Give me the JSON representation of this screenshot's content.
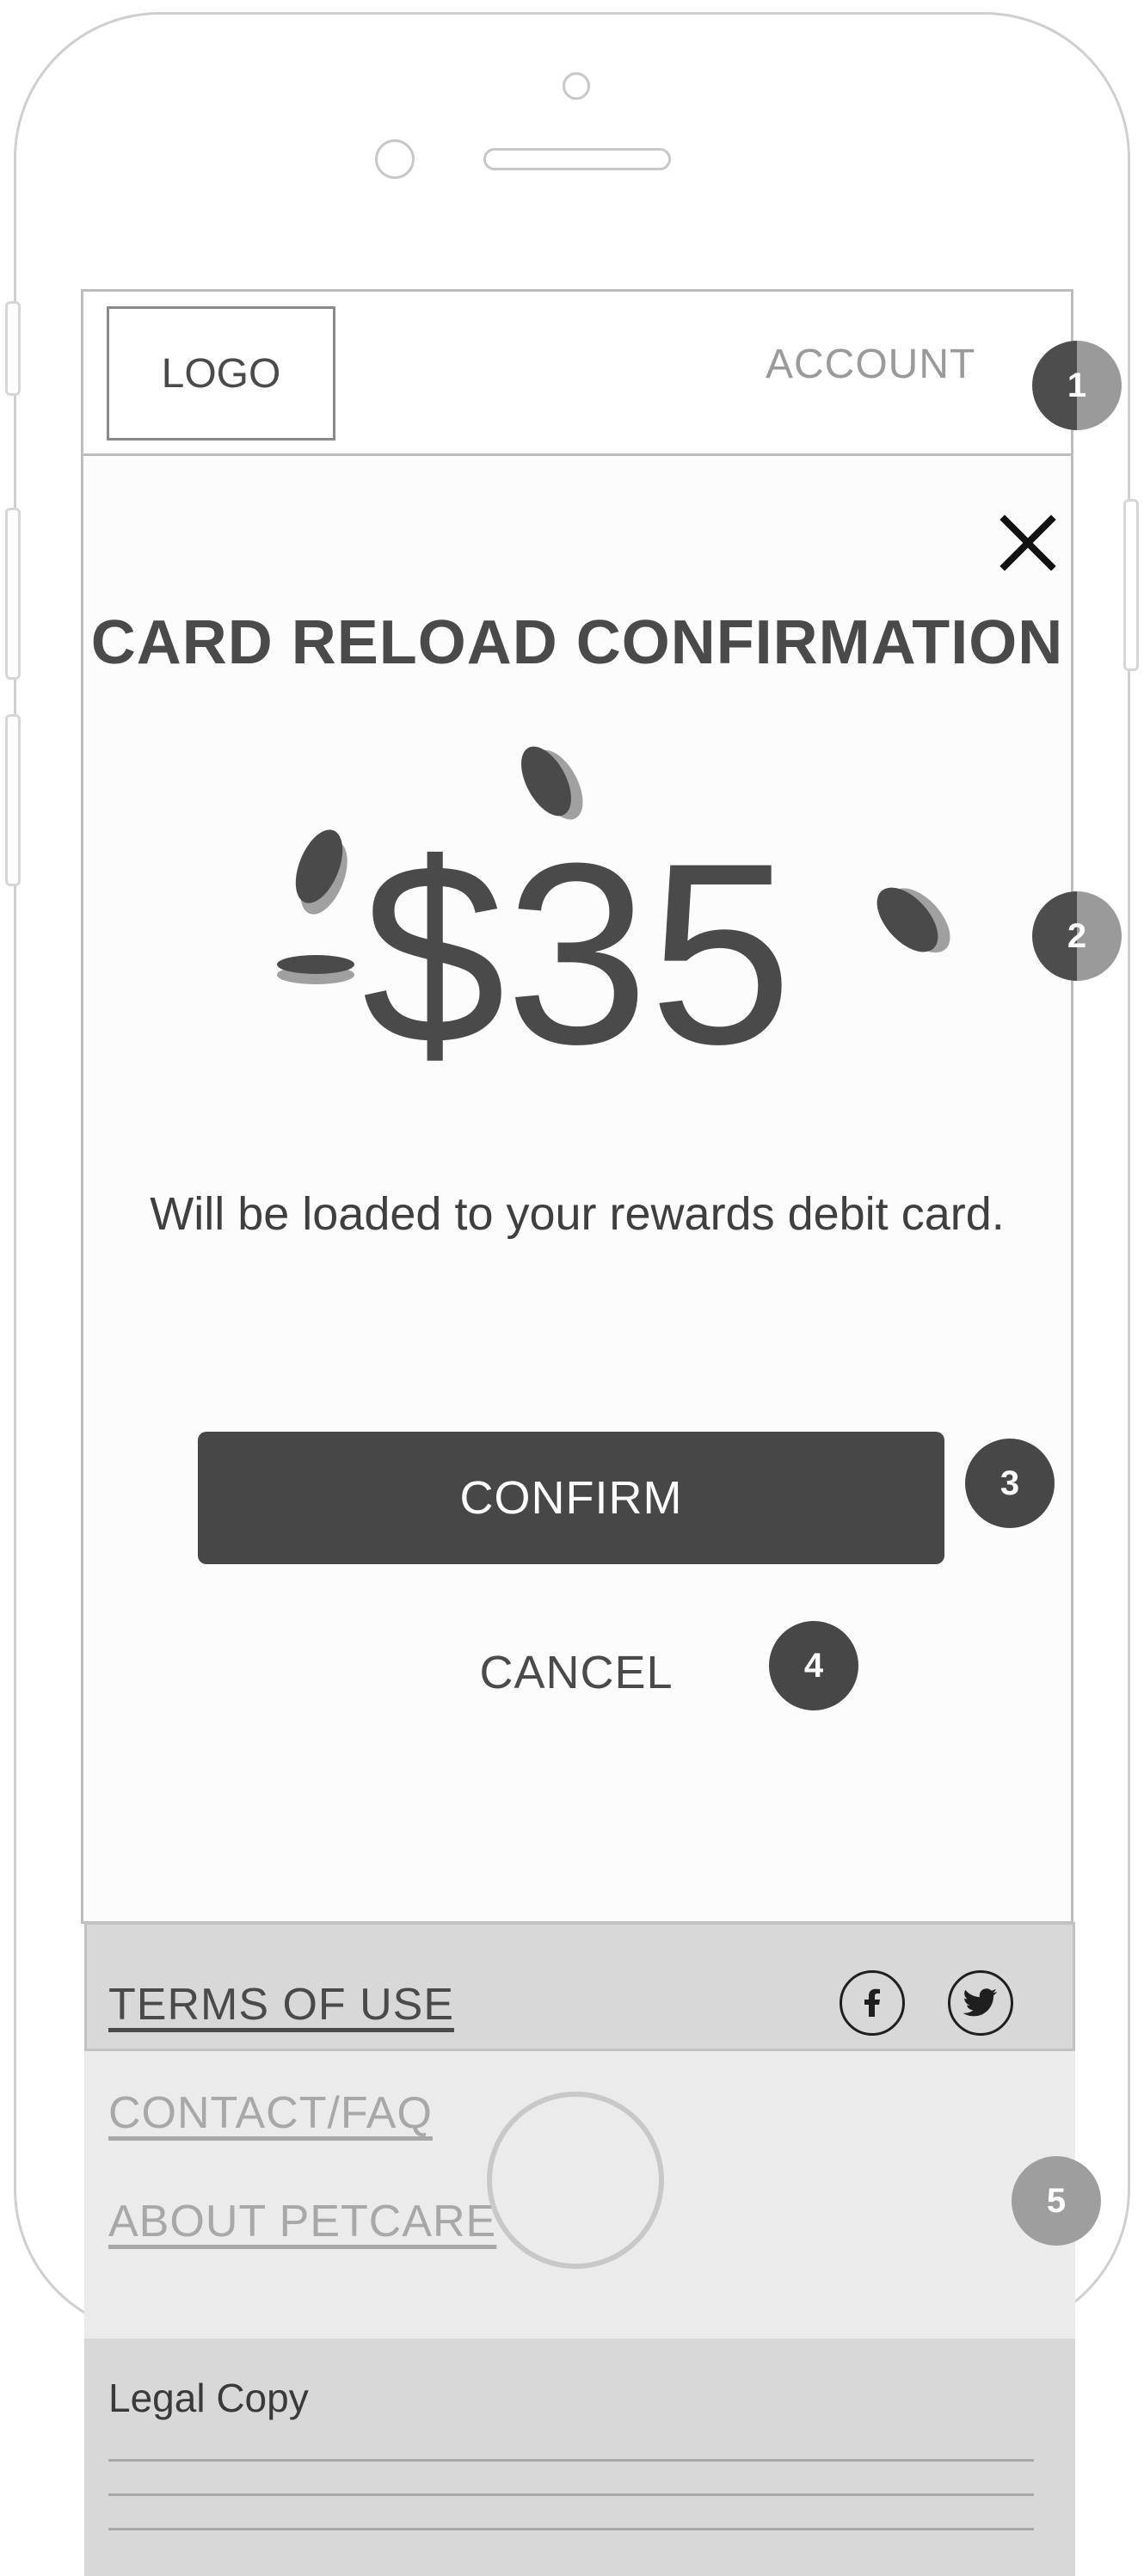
{
  "header": {
    "logo": "LOGO",
    "account": "ACCOUNT"
  },
  "modal": {
    "title": "CARD RELOAD CONFIRMATION",
    "amount": "$35",
    "message": "Will be loaded to your rewards debit card.",
    "confirm_label": "CONFIRM",
    "cancel_label": "CANCEL",
    "close_icon": "close-icon",
    "coin_icon": "coin-icon"
  },
  "annotations": [
    "1",
    "2",
    "3",
    "4",
    "5"
  ],
  "footer": {
    "links": [
      "TERMS OF USE",
      "CONTACT/FAQ",
      "ABOUT PETCARE"
    ],
    "social": [
      "facebook-icon",
      "twitter-icon"
    ],
    "legal": "Legal Copy"
  },
  "colors": {
    "primary": "#474747",
    "muted": "#9a9a9a",
    "footer_bg": "#d8d8d8",
    "footer_mid_bg": "#ebebeb"
  }
}
